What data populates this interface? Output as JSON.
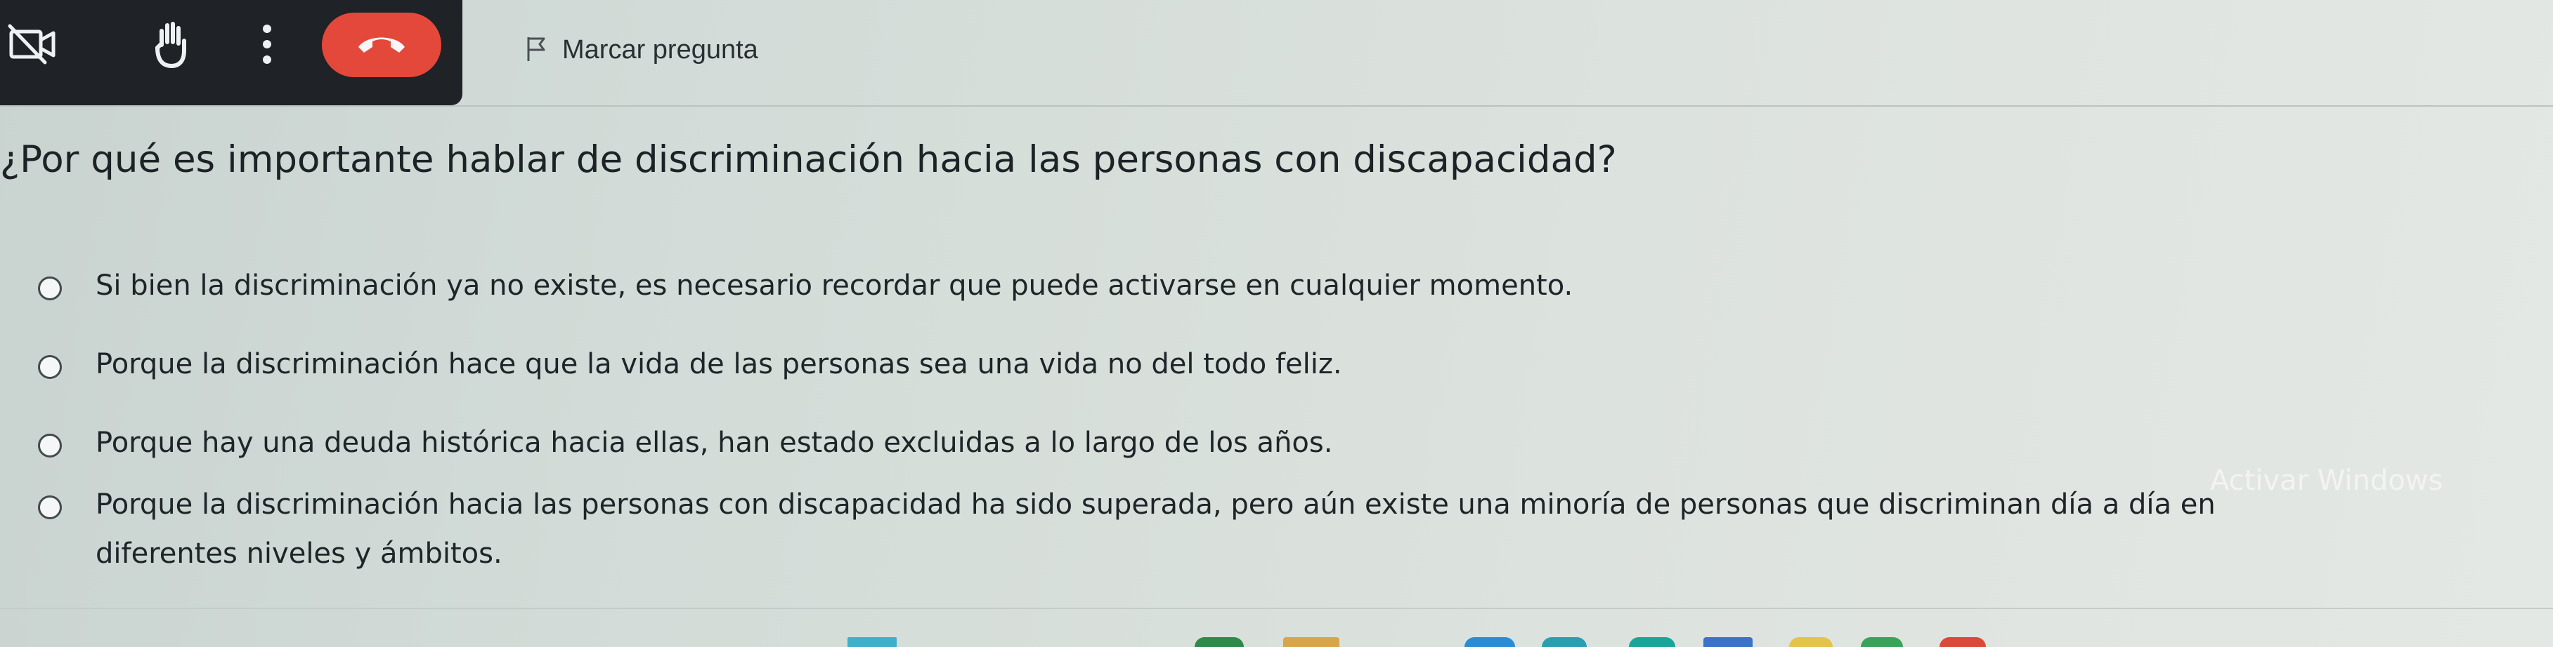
{
  "call_controls": {
    "camera_off_icon": "camera-off-icon",
    "raise_hand_icon": "raise-hand-icon",
    "more_options_icon": "more-vert-icon",
    "end_call_icon": "phone-hangup-icon",
    "end_call_color": "#e4483a",
    "bar_color": "#1f2226"
  },
  "flag": {
    "icon": "flag-outline-icon",
    "label": "Marcar pregunta"
  },
  "question": {
    "text": "¿Por qué es importante hablar de discriminación hacia las personas con discapacidad?"
  },
  "options": [
    {
      "label": "Si bien la discriminación ya no existe, es necesario recordar que puede activarse en cualquier momento.",
      "selected": false
    },
    {
      "label": "Porque la discriminación hace que la vida de las personas sea una vida no del todo feliz.",
      "selected": false
    },
    {
      "label": "Porque hay una deuda histórica hacia ellas, han estado excluidas a lo largo de los años.",
      "selected": false
    },
    {
      "label_line1": "Porque la discriminación hacia las personas con discapacidad ha sido superada, pero aún existe una minoría de personas que discriminan día a día en",
      "label_line2": "diferentes niveles y ámbitos.",
      "selected": false
    }
  ],
  "watermark": {
    "text": "Activar Windows"
  },
  "taskbar": {
    "colors": [
      "#3fb0c9",
      "#2f8a4a",
      "#d8a64a",
      "#2b8cd6",
      "#2a9fb0",
      "#1aa59a",
      "#3a73c8",
      "#e4c34a",
      "#3aa35a",
      "#d94a3a"
    ]
  }
}
